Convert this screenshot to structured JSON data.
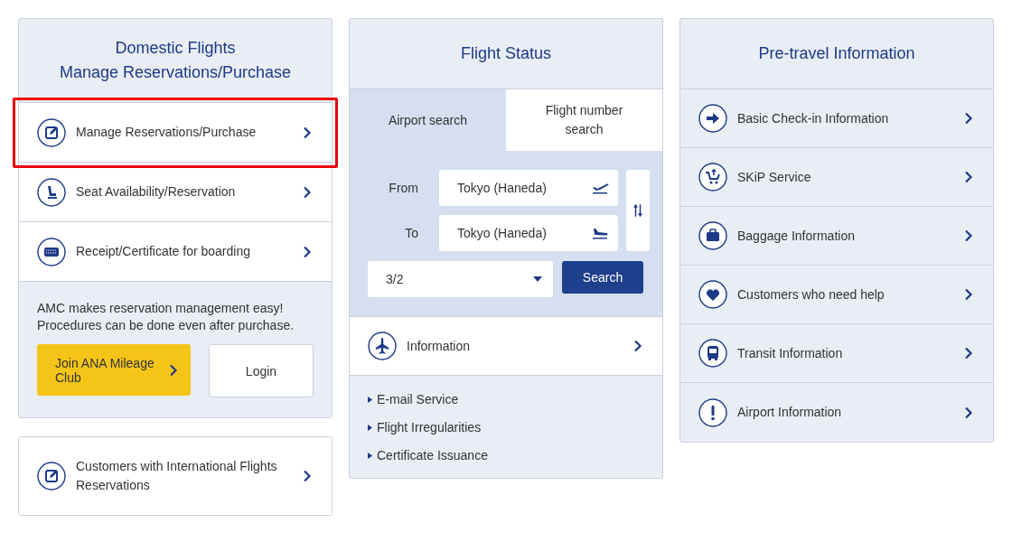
{
  "domestic": {
    "title_lines": [
      "Domestic Flights",
      "Manage Reservations/Purchase"
    ],
    "items": [
      {
        "label": "Manage Reservations/Purchase",
        "highlighted": true
      },
      {
        "label": "Seat Availability/Reservation",
        "highlighted": false
      },
      {
        "label": "Receipt/Certificate for boarding",
        "highlighted": false
      }
    ],
    "promo": {
      "text_lines": [
        "AMC makes reservation management easy!",
        "Procedures can be done even after purchase."
      ],
      "join_button": "Join ANA Mileage Club",
      "login_button": "Login"
    }
  },
  "international": {
    "label": "Customers with International Flights Reservations"
  },
  "flight_status": {
    "title": "Flight Status",
    "tabs": [
      {
        "label": "Airport search",
        "selected": true
      },
      {
        "label": "Flight number search",
        "selected": false
      }
    ],
    "from": {
      "label": "From",
      "value": "Tokyo (Haneda)"
    },
    "to": {
      "label": "To",
      "value": "Tokyo (Haneda)"
    },
    "date": "3/2",
    "search_button": "Search",
    "info_item": "Information",
    "links": [
      "E-mail Service",
      "Flight Irregularities",
      "Certificate Issuance"
    ]
  },
  "pre_travel": {
    "title": "Pre-travel Information",
    "items": [
      "Basic Check-in Information",
      "SKiP Service",
      "Baggage Information",
      "Customers who need help",
      "Transit Information",
      "Airport Information"
    ]
  }
}
